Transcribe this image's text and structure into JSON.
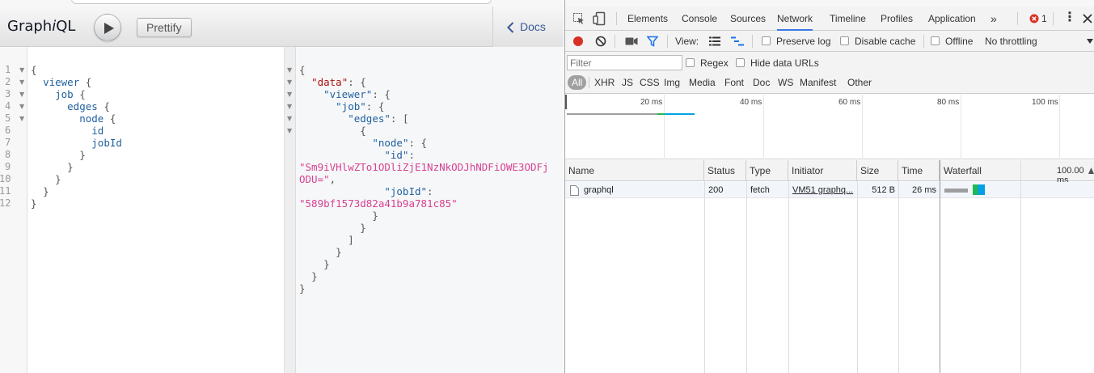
{
  "graphiql": {
    "title_pre": "Graph",
    "title_em": "i",
    "title_post": "QL",
    "prettify_label": "Prettify",
    "docs_label": "Docs",
    "query_lines": [
      {
        "num": "1",
        "fold": true
      },
      {
        "num": "2",
        "fold": true
      },
      {
        "num": "3",
        "fold": true
      },
      {
        "num": "4",
        "fold": true
      },
      {
        "num": "5",
        "fold": true
      },
      {
        "num": "6",
        "fold": false
      },
      {
        "num": "7",
        "fold": false
      },
      {
        "num": "8",
        "fold": false
      },
      {
        "num": "9",
        "fold": false
      },
      {
        "num": "10",
        "fold": false
      },
      {
        "num": "11",
        "fold": false
      },
      {
        "num": "12",
        "fold": false
      }
    ],
    "query_tokens": {
      "viewer": "viewer",
      "job": "job",
      "edges": "edges",
      "node": "node",
      "id": "id",
      "jobId": "jobId"
    },
    "result": {
      "data_key": "\"data\"",
      "viewer_key": "\"viewer\"",
      "job_key": "\"job\"",
      "edges_key": "\"edges\"",
      "node_key": "\"node\"",
      "id_key": "\"id\"",
      "id_value_line1": "\"Sm9iVHlwZTo1ODliZjE1NzNkODJhNDFiOWE3ODFj",
      "id_value_line2": "ODU=\"",
      "jobId_key": "\"jobId\"",
      "jobId_value": "\"589bf1573d82a41b9a781c85\""
    }
  },
  "devtools": {
    "tabs": [
      "Elements",
      "Console",
      "Sources",
      "Network",
      "Timeline",
      "Profiles",
      "Application"
    ],
    "active_tab": "Network",
    "more_tabs": "»",
    "error_count": "1",
    "toolbar": {
      "view_label": "View:",
      "preserve_log": "Preserve log",
      "disable_cache": "Disable cache",
      "offline": "Offline",
      "throttling": "No throttling"
    },
    "filter": {
      "placeholder": "Filter",
      "regex": "Regex",
      "hide_data_urls": "Hide data URLs",
      "types": [
        "All",
        "XHR",
        "JS",
        "CSS",
        "Img",
        "Media",
        "Font",
        "Doc",
        "WS",
        "Manifest",
        "Other"
      ]
    },
    "overview_ticks": [
      "20 ms",
      "40 ms",
      "60 ms",
      "80 ms",
      "100 ms"
    ],
    "columns": [
      "Name",
      "Status",
      "Type",
      "Initiator",
      "Size",
      "Time",
      "Waterfall"
    ],
    "waterfall_scale": "100.00 ms",
    "requests": [
      {
        "name": "graphql",
        "status": "200",
        "type": "fetch",
        "initiator": "VM51 graphq...",
        "size": "512 B",
        "time": "26 ms"
      }
    ],
    "colors": {
      "accent": "#3b78e7",
      "record": "#d93025",
      "filter": "#1a73e8",
      "waiting": "#9e9e9e",
      "receiving": "#00a0e9",
      "ttfb": "#1db954"
    }
  }
}
